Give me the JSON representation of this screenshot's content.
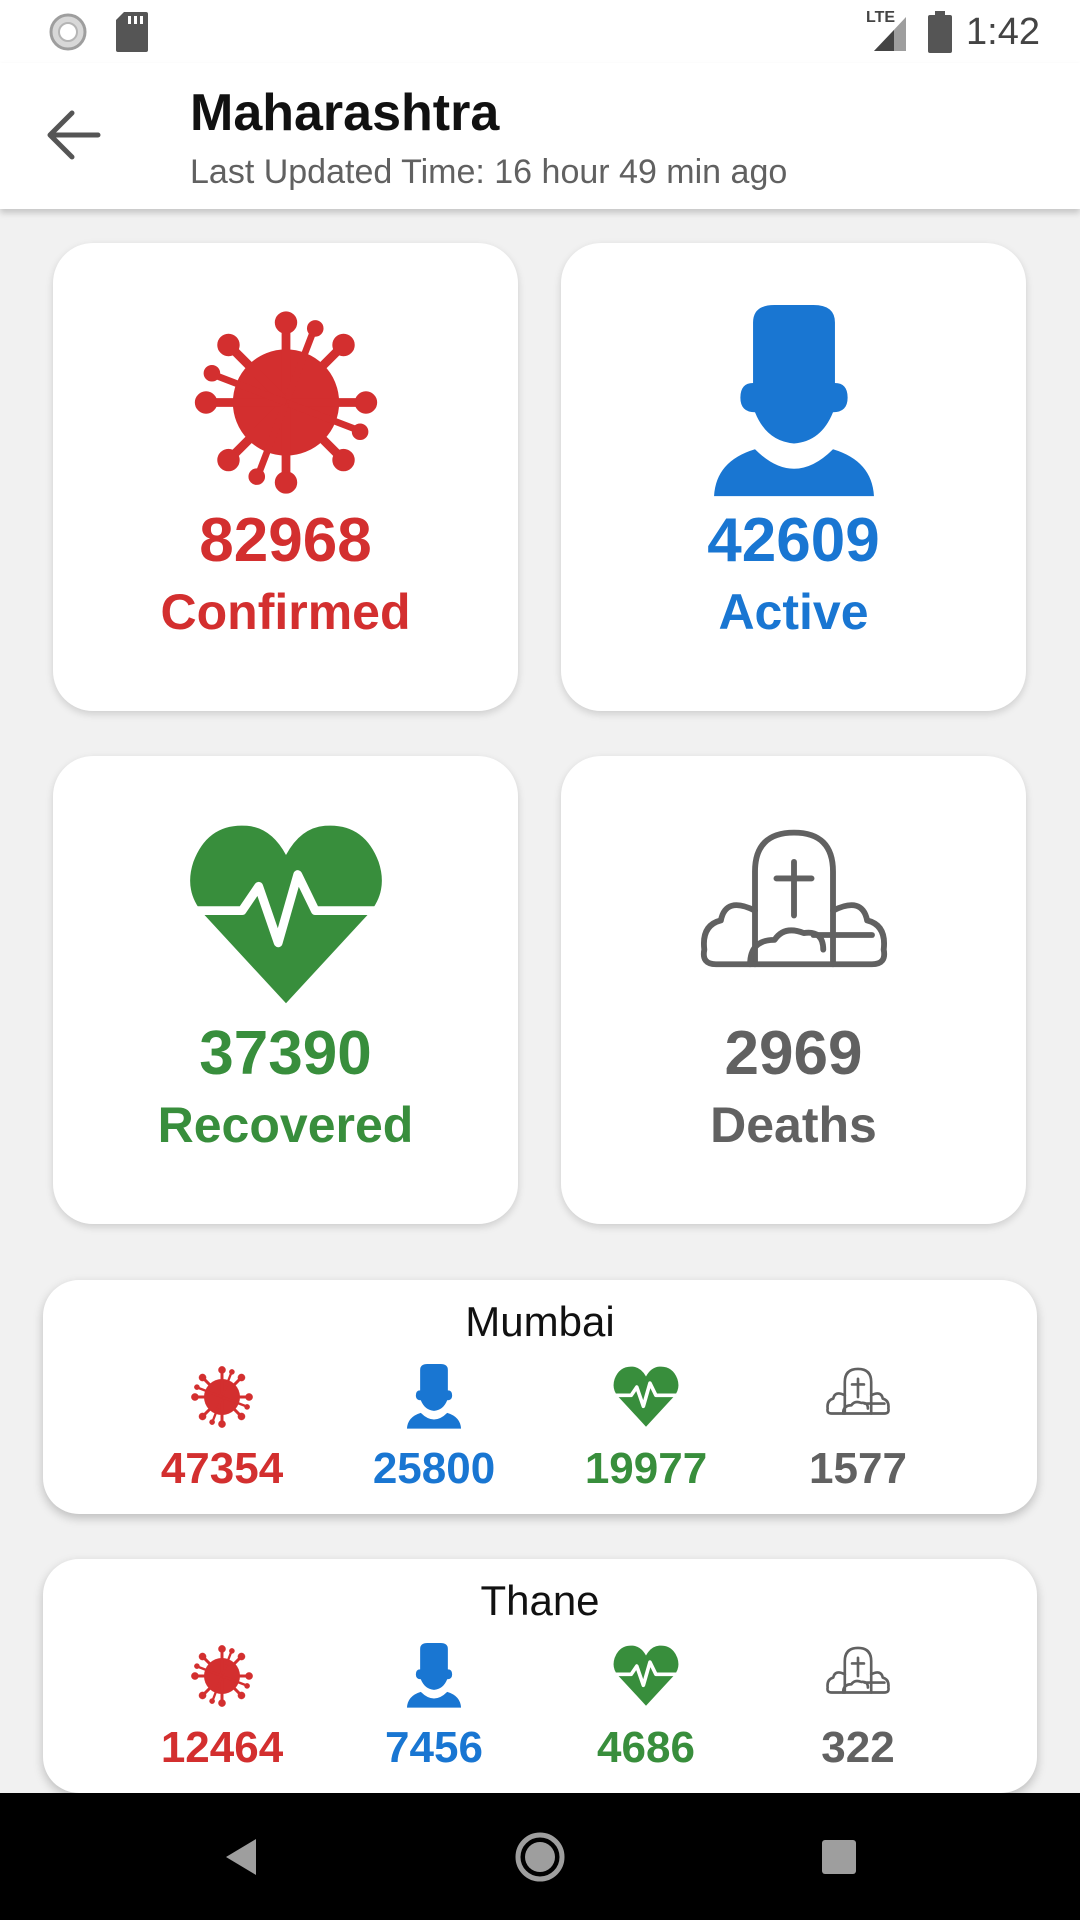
{
  "status": {
    "time": "1:42",
    "network": "LTE"
  },
  "header": {
    "title": "Maharashtra",
    "subtitle": "Last Updated Time: 16 hour 49 min ago"
  },
  "colors": {
    "confirmed": "#d32f2f",
    "active": "#1976d2",
    "recovered": "#388e3c",
    "deaths": "#616161"
  },
  "summary": {
    "confirmed": {
      "value": "82968",
      "label": "Confirmed",
      "icon": "virus-icon"
    },
    "active": {
      "value": "42609",
      "label": "Active",
      "icon": "person-icon"
    },
    "recovered": {
      "value": "37390",
      "label": "Recovered",
      "icon": "heart-pulse-icon"
    },
    "deaths": {
      "value": "2969",
      "label": "Deaths",
      "icon": "grave-icon"
    }
  },
  "districts": [
    {
      "name": "Mumbai",
      "confirmed": "47354",
      "active": "25800",
      "recovered": "19977",
      "deaths": "1577"
    },
    {
      "name": "Thane",
      "confirmed": "12464",
      "active": "7456",
      "recovered": "4686",
      "deaths": "322"
    }
  ]
}
